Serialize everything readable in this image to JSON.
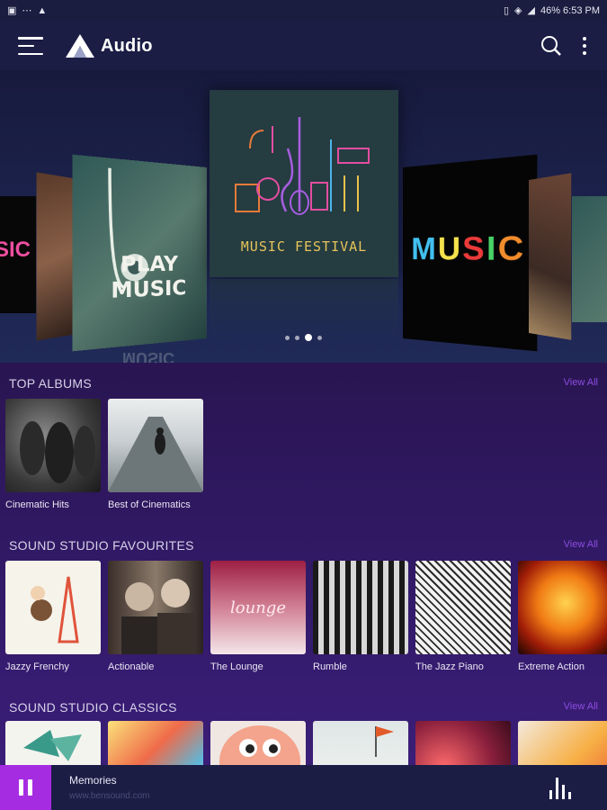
{
  "status_bar": {
    "right_text": "46% 6:53 PM",
    "icons": [
      "image-icon",
      "notification-icon",
      "warning-icon",
      "vibrate-icon",
      "wifi-icon",
      "signal-icon",
      "battery-icon"
    ]
  },
  "app_bar": {
    "title": "Audio",
    "icons": [
      "menu-icon",
      "app-logo-icon",
      "search-icon",
      "more-vert-icon"
    ]
  },
  "carousel": {
    "center_slide_text": "MUSIC FESTIVAL",
    "left_slide_text": "PLAY MUSIC",
    "left_slide_line1": "PLAY",
    "left_slide_line2": "MUSIC",
    "right_slide_letters": [
      "M",
      "U",
      "S",
      "I",
      "C"
    ],
    "page_count": 4,
    "active_page": 3
  },
  "top_albums": {
    "title": "TOP ALBUMS",
    "view_all": "View All",
    "items": [
      {
        "label": "Cinematic Hits"
      },
      {
        "label": "Best of Cinematics"
      }
    ]
  },
  "favourites": {
    "title": "SOUND STUDIO FAVOURITES",
    "view_all": "View All",
    "items": [
      {
        "label": "Jazzy Frenchy"
      },
      {
        "label": "Actionable"
      },
      {
        "label": "The Lounge",
        "thumb_text": "lounge"
      },
      {
        "label": "Rumble"
      },
      {
        "label": "The Jazz Piano"
      },
      {
        "label": "Extreme Action"
      }
    ]
  },
  "classics": {
    "title": "SOUND STUDIO CLASSICS",
    "view_all": "View All"
  },
  "player": {
    "track_title": "Memories",
    "track_source": "www.bensound.com",
    "icons": [
      "pause-icon",
      "equalizer-icon"
    ]
  },
  "colors": {
    "accent": "#a62ce2",
    "view_all": "#8c4ce0",
    "app_bar": "#1b1d45",
    "content_bg": "#2a1552"
  }
}
